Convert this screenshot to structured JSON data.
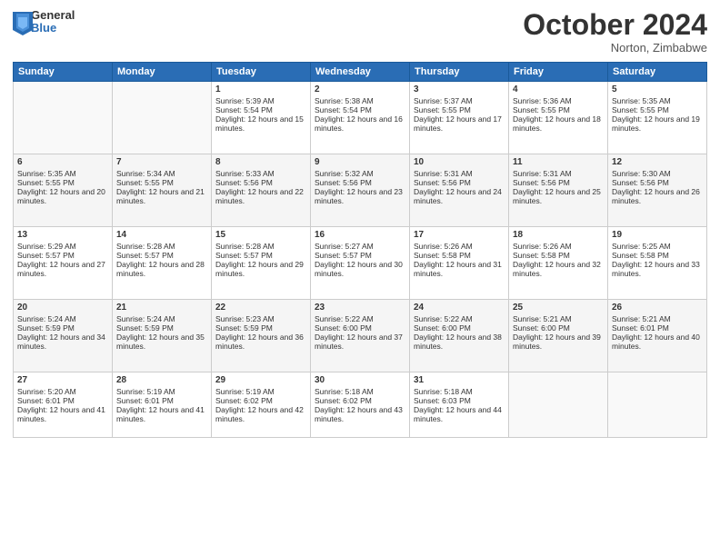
{
  "header": {
    "logo": {
      "general": "General",
      "blue": "Blue"
    },
    "title": "October 2024",
    "location": "Norton, Zimbabwe"
  },
  "weekdays": [
    "Sunday",
    "Monday",
    "Tuesday",
    "Wednesday",
    "Thursday",
    "Friday",
    "Saturday"
  ],
  "weeks": [
    [
      {
        "day": "",
        "sunrise": "",
        "sunset": "",
        "daylight": ""
      },
      {
        "day": "",
        "sunrise": "",
        "sunset": "",
        "daylight": ""
      },
      {
        "day": "1",
        "sunrise": "Sunrise: 5:39 AM",
        "sunset": "Sunset: 5:54 PM",
        "daylight": "Daylight: 12 hours and 15 minutes."
      },
      {
        "day": "2",
        "sunrise": "Sunrise: 5:38 AM",
        "sunset": "Sunset: 5:54 PM",
        "daylight": "Daylight: 12 hours and 16 minutes."
      },
      {
        "day": "3",
        "sunrise": "Sunrise: 5:37 AM",
        "sunset": "Sunset: 5:55 PM",
        "daylight": "Daylight: 12 hours and 17 minutes."
      },
      {
        "day": "4",
        "sunrise": "Sunrise: 5:36 AM",
        "sunset": "Sunset: 5:55 PM",
        "daylight": "Daylight: 12 hours and 18 minutes."
      },
      {
        "day": "5",
        "sunrise": "Sunrise: 5:35 AM",
        "sunset": "Sunset: 5:55 PM",
        "daylight": "Daylight: 12 hours and 19 minutes."
      }
    ],
    [
      {
        "day": "6",
        "sunrise": "Sunrise: 5:35 AM",
        "sunset": "Sunset: 5:55 PM",
        "daylight": "Daylight: 12 hours and 20 minutes."
      },
      {
        "day": "7",
        "sunrise": "Sunrise: 5:34 AM",
        "sunset": "Sunset: 5:55 PM",
        "daylight": "Daylight: 12 hours and 21 minutes."
      },
      {
        "day": "8",
        "sunrise": "Sunrise: 5:33 AM",
        "sunset": "Sunset: 5:56 PM",
        "daylight": "Daylight: 12 hours and 22 minutes."
      },
      {
        "day": "9",
        "sunrise": "Sunrise: 5:32 AM",
        "sunset": "Sunset: 5:56 PM",
        "daylight": "Daylight: 12 hours and 23 minutes."
      },
      {
        "day": "10",
        "sunrise": "Sunrise: 5:31 AM",
        "sunset": "Sunset: 5:56 PM",
        "daylight": "Daylight: 12 hours and 24 minutes."
      },
      {
        "day": "11",
        "sunrise": "Sunrise: 5:31 AM",
        "sunset": "Sunset: 5:56 PM",
        "daylight": "Daylight: 12 hours and 25 minutes."
      },
      {
        "day": "12",
        "sunrise": "Sunrise: 5:30 AM",
        "sunset": "Sunset: 5:56 PM",
        "daylight": "Daylight: 12 hours and 26 minutes."
      }
    ],
    [
      {
        "day": "13",
        "sunrise": "Sunrise: 5:29 AM",
        "sunset": "Sunset: 5:57 PM",
        "daylight": "Daylight: 12 hours and 27 minutes."
      },
      {
        "day": "14",
        "sunrise": "Sunrise: 5:28 AM",
        "sunset": "Sunset: 5:57 PM",
        "daylight": "Daylight: 12 hours and 28 minutes."
      },
      {
        "day": "15",
        "sunrise": "Sunrise: 5:28 AM",
        "sunset": "Sunset: 5:57 PM",
        "daylight": "Daylight: 12 hours and 29 minutes."
      },
      {
        "day": "16",
        "sunrise": "Sunrise: 5:27 AM",
        "sunset": "Sunset: 5:57 PM",
        "daylight": "Daylight: 12 hours and 30 minutes."
      },
      {
        "day": "17",
        "sunrise": "Sunrise: 5:26 AM",
        "sunset": "Sunset: 5:58 PM",
        "daylight": "Daylight: 12 hours and 31 minutes."
      },
      {
        "day": "18",
        "sunrise": "Sunrise: 5:26 AM",
        "sunset": "Sunset: 5:58 PM",
        "daylight": "Daylight: 12 hours and 32 minutes."
      },
      {
        "day": "19",
        "sunrise": "Sunrise: 5:25 AM",
        "sunset": "Sunset: 5:58 PM",
        "daylight": "Daylight: 12 hours and 33 minutes."
      }
    ],
    [
      {
        "day": "20",
        "sunrise": "Sunrise: 5:24 AM",
        "sunset": "Sunset: 5:59 PM",
        "daylight": "Daylight: 12 hours and 34 minutes."
      },
      {
        "day": "21",
        "sunrise": "Sunrise: 5:24 AM",
        "sunset": "Sunset: 5:59 PM",
        "daylight": "Daylight: 12 hours and 35 minutes."
      },
      {
        "day": "22",
        "sunrise": "Sunrise: 5:23 AM",
        "sunset": "Sunset: 5:59 PM",
        "daylight": "Daylight: 12 hours and 36 minutes."
      },
      {
        "day": "23",
        "sunrise": "Sunrise: 5:22 AM",
        "sunset": "Sunset: 6:00 PM",
        "daylight": "Daylight: 12 hours and 37 minutes."
      },
      {
        "day": "24",
        "sunrise": "Sunrise: 5:22 AM",
        "sunset": "Sunset: 6:00 PM",
        "daylight": "Daylight: 12 hours and 38 minutes."
      },
      {
        "day": "25",
        "sunrise": "Sunrise: 5:21 AM",
        "sunset": "Sunset: 6:00 PM",
        "daylight": "Daylight: 12 hours and 39 minutes."
      },
      {
        "day": "26",
        "sunrise": "Sunrise: 5:21 AM",
        "sunset": "Sunset: 6:01 PM",
        "daylight": "Daylight: 12 hours and 40 minutes."
      }
    ],
    [
      {
        "day": "27",
        "sunrise": "Sunrise: 5:20 AM",
        "sunset": "Sunset: 6:01 PM",
        "daylight": "Daylight: 12 hours and 41 minutes."
      },
      {
        "day": "28",
        "sunrise": "Sunrise: 5:19 AM",
        "sunset": "Sunset: 6:01 PM",
        "daylight": "Daylight: 12 hours and 41 minutes."
      },
      {
        "day": "29",
        "sunrise": "Sunrise: 5:19 AM",
        "sunset": "Sunset: 6:02 PM",
        "daylight": "Daylight: 12 hours and 42 minutes."
      },
      {
        "day": "30",
        "sunrise": "Sunrise: 5:18 AM",
        "sunset": "Sunset: 6:02 PM",
        "daylight": "Daylight: 12 hours and 43 minutes."
      },
      {
        "day": "31",
        "sunrise": "Sunrise: 5:18 AM",
        "sunset": "Sunset: 6:03 PM",
        "daylight": "Daylight: 12 hours and 44 minutes."
      },
      {
        "day": "",
        "sunrise": "",
        "sunset": "",
        "daylight": ""
      },
      {
        "day": "",
        "sunrise": "",
        "sunset": "",
        "daylight": ""
      }
    ]
  ]
}
